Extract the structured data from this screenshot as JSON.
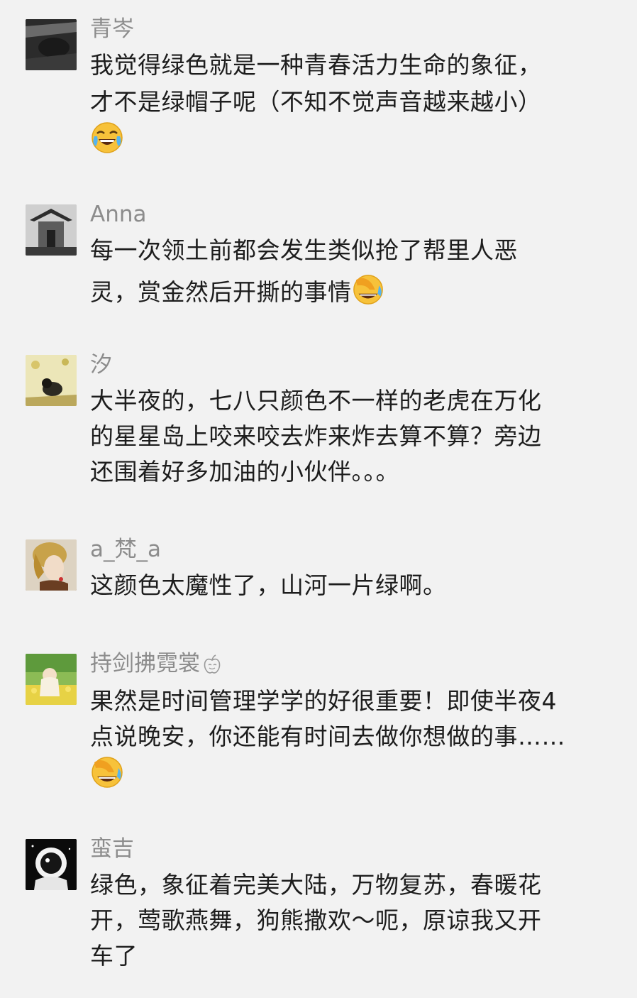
{
  "comments": [
    {
      "username": "青岑",
      "lines": [
        "我觉得绿色就是一种青春活力生命的象征，",
        "才不是绿帽子呢（不知不觉声音越来越小）"
      ],
      "emoji": "joy-tears-emoji"
    },
    {
      "username": "Anna",
      "lines": [
        "每一次领土前都会发生类似抢了帮里人恶",
        "灵，赏金然后开撕的事情"
      ],
      "emoji": "facepalm-laugh-emoji"
    },
    {
      "username": "汐",
      "lines": [
        "大半夜的，七八只颜色不一样的老虎在万化",
        "的星星岛上咬来咬去炸来炸去算不算？旁边",
        "还围着好多加油的小伙伴。。。"
      ]
    },
    {
      "username": "a_梵_a",
      "lines": [
        "这颜色太魔性了，山河一片绿啊。"
      ]
    },
    {
      "username": "持剑拂霓裳",
      "lines": [
        "果然是时间管理学学的好很重要！即使半夜4",
        "点说晚安，你还能有时间去做你想做的事……"
      ],
      "emoji": "facepalm-laugh-emoji"
    },
    {
      "username": "蛮吉",
      "lines": [
        "绿色，象征着完美大陆，万物复苏，春暖花",
        "开，莺歌燕舞，狗熊撒欢～呃，原谅我又开",
        "车了"
      ]
    }
  ]
}
